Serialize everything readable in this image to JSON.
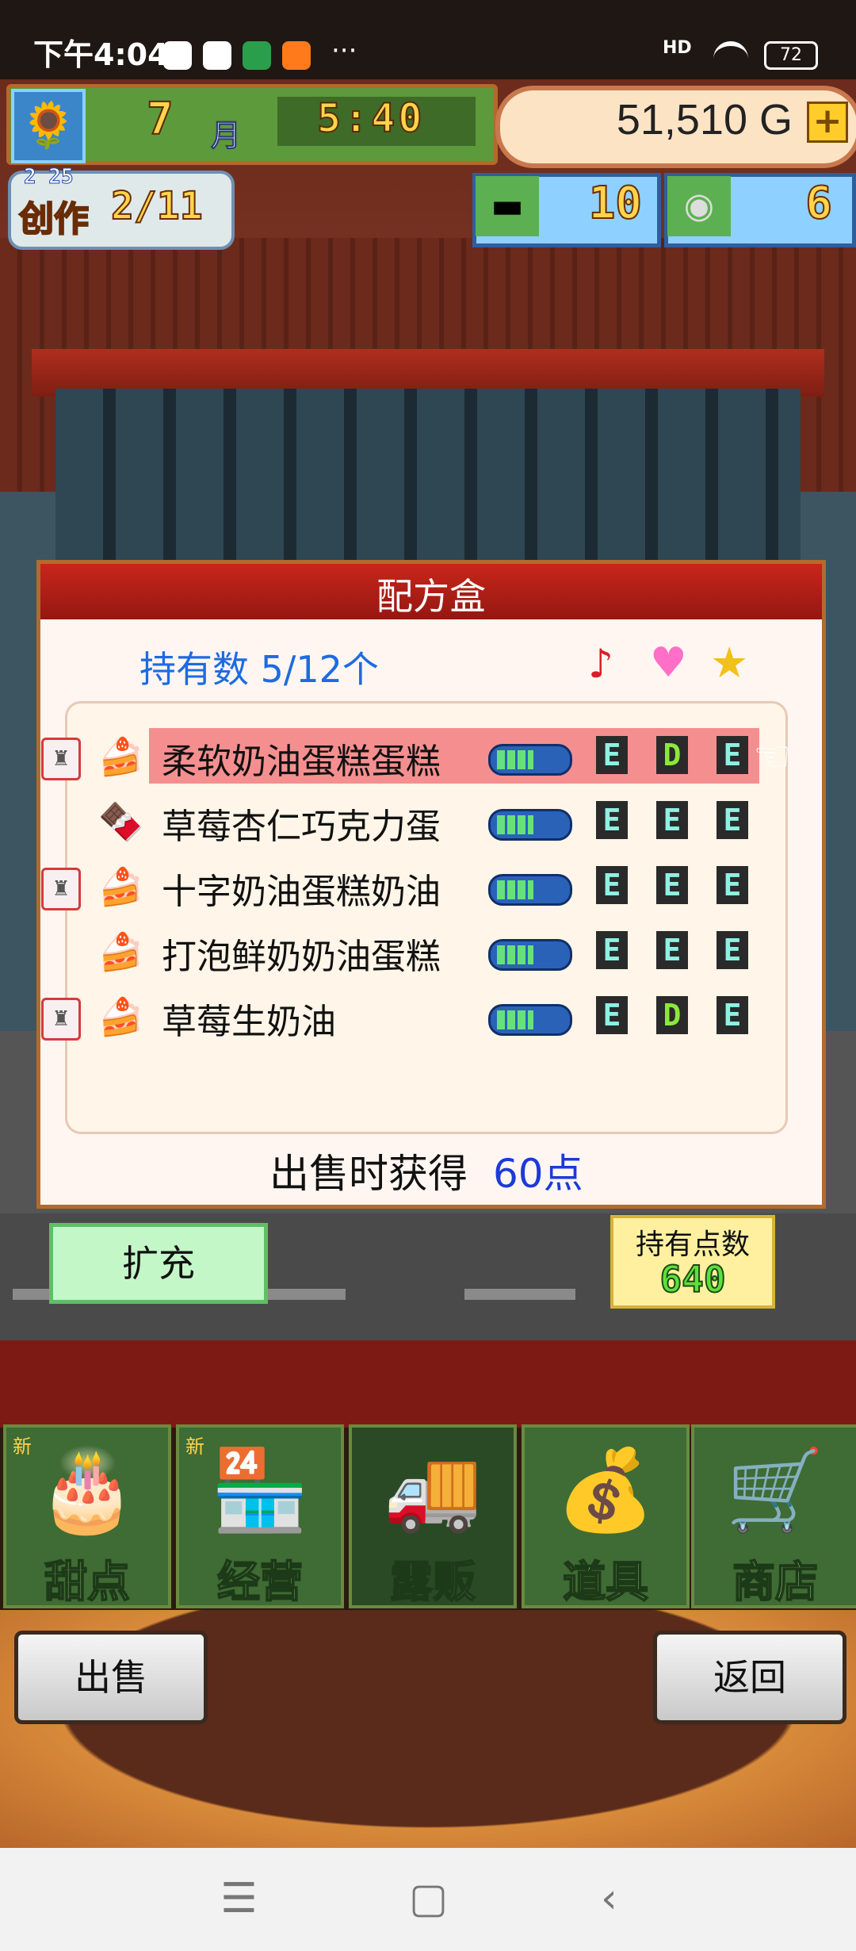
{
  "status_bar": {
    "time": "下午4:04",
    "extra": "···",
    "signal": "HD",
    "battery": "72"
  },
  "hud": {
    "month_number": "7",
    "month_unit": "月",
    "clock": "5:40",
    "gold": "51,510 G",
    "gold_add": "+",
    "create_date": "2 25",
    "create_label": "创作",
    "create_progress": "2/11",
    "tickets": "10",
    "medals": "6"
  },
  "dialog": {
    "title": "配方盒",
    "owned": "持有数 5/12个",
    "recipes": [
      {
        "name": "柔软奶油蛋糕蛋糕",
        "chef": true,
        "cake": "🍰",
        "bar": 0.55,
        "grades": [
          "E",
          "D",
          "E"
        ],
        "selected": true
      },
      {
        "name": "草莓杏仁巧克力蛋",
        "chef": false,
        "cake": "🍫",
        "bar": 0.55,
        "grades": [
          "E",
          "E",
          "E"
        ],
        "selected": false
      },
      {
        "name": "十字奶油蛋糕奶油",
        "chef": true,
        "cake": "🍰",
        "bar": 0.55,
        "grades": [
          "E",
          "E",
          "E"
        ],
        "selected": false
      },
      {
        "name": "打泡鲜奶奶油蛋糕",
        "chef": false,
        "cake": "🍰",
        "bar": 0.55,
        "grades": [
          "E",
          "E",
          "E"
        ],
        "selected": false
      },
      {
        "name": "草莓生奶油",
        "chef": true,
        "cake": "🍰",
        "bar": 0.55,
        "grades": [
          "E",
          "D",
          "E"
        ],
        "selected": false
      }
    ],
    "earn_label": "出售时获得",
    "earn_value": "60点"
  },
  "actions": {
    "expand": "扩充",
    "points_label": "持有点数",
    "points_value": "640"
  },
  "tabs": [
    {
      "label": "甜点",
      "icon": "cake-icon",
      "new": "新"
    },
    {
      "label": "经营",
      "icon": "shop-icon",
      "new": "新"
    },
    {
      "label": "露贩",
      "icon": "truck-icon",
      "new": ""
    },
    {
      "label": "道具",
      "icon": "bag-icon",
      "new": ""
    },
    {
      "label": "商店",
      "icon": "cart-icon",
      "new": ""
    }
  ],
  "bottom": {
    "sell": "出售",
    "back": "返回"
  }
}
